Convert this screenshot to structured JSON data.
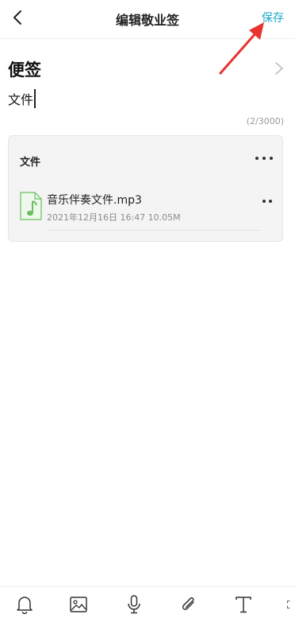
{
  "header": {
    "title": "编辑敬业签",
    "save_label": "保存"
  },
  "note": {
    "category": "便签",
    "text": "文件",
    "counter": "(2/3000)"
  },
  "attachments": {
    "title": "文件",
    "files": [
      {
        "name": "音乐伴奏文件.mp3",
        "meta": "2021年12月16日 16:47 10.05M",
        "icon": "music-file-icon"
      }
    ]
  },
  "toolbar": {
    "items": [
      "bell-icon",
      "image-icon",
      "microphone-icon",
      "paperclip-icon",
      "text-icon",
      "expand-icon"
    ]
  },
  "colors": {
    "accent": "#19a9c8",
    "annotation_arrow": "#e8332f",
    "file_icon": "#6cbf61",
    "card_bg": "#f4f4f4"
  }
}
